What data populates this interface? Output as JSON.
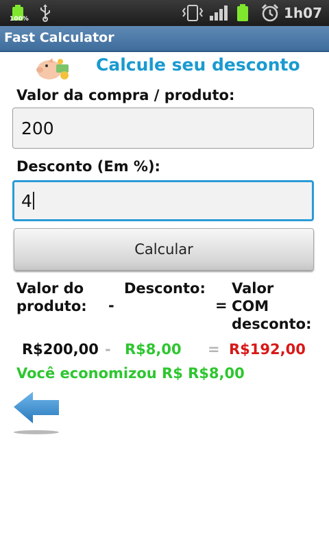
{
  "status_bar": {
    "battery_percent": "100%",
    "time": "1h07",
    "icons": [
      "battery-charging-icon",
      "usb-icon",
      "vibrate-icon",
      "signal-icon",
      "battery-icon",
      "alarm-icon"
    ]
  },
  "app": {
    "title": "Fast Calculator"
  },
  "main": {
    "heading": "Calcule seu desconto",
    "icon": "piggy-bank-icon",
    "purchase_label": "Valor da compra / produto:",
    "purchase_value": "200",
    "discount_label": "Desconto (Em %):",
    "discount_value": "4",
    "calc_button": "Calcular"
  },
  "results": {
    "col1_header": [
      "Valor do",
      "produto:"
    ],
    "col2_header": "Desconto:",
    "col3_header": [
      "Valor",
      "COM",
      "desconto:"
    ],
    "op_minus": "-",
    "op_equals": "=",
    "product_value": "R$200,00",
    "discount_amount": "R$8,00",
    "final_value": "R$192,00",
    "savings_text": "Você economizou R$ R$8,00"
  },
  "colors": {
    "accent": "#1a9ad0",
    "green": "#2ec630",
    "red": "#d81818",
    "title_bar": "#4a78a6",
    "arrow": "#3b8fce"
  }
}
